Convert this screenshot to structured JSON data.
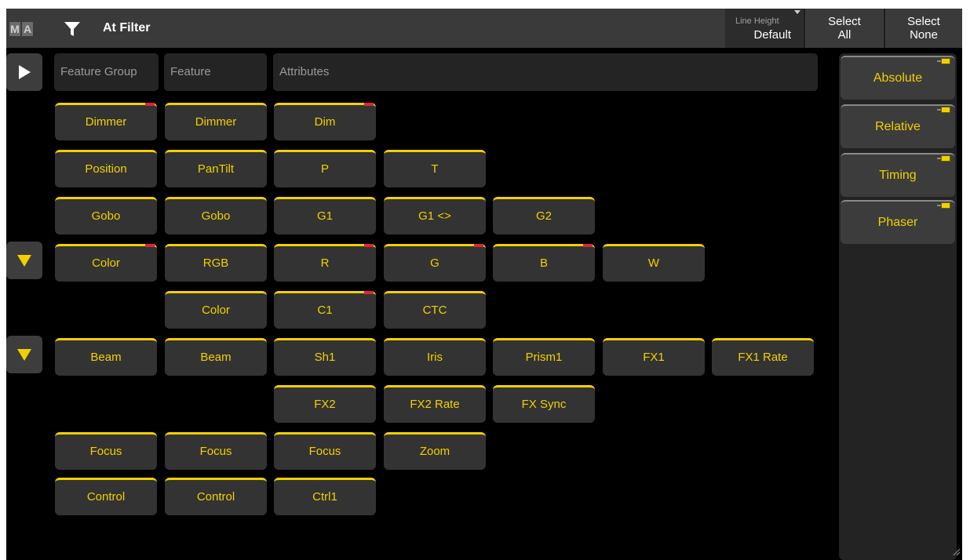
{
  "logo": [
    "M",
    "A"
  ],
  "title": "At Filter",
  "line_height": {
    "label": "Line Height",
    "value": "Default"
  },
  "select_all": {
    "line1": "Select",
    "line2": "All"
  },
  "select_none": {
    "line1": "Select",
    "line2": "None"
  },
  "columns": {
    "feature_group": "Feature Group",
    "feature": "Feature",
    "attributes": "Attributes"
  },
  "rows": [
    {
      "group": "Dimmer",
      "feature": "Dimmer",
      "attributes": [
        "Dim"
      ]
    },
    {
      "group": "Position",
      "feature": "PanTilt",
      "attributes": [
        "P",
        "T"
      ]
    },
    {
      "group": "Gobo",
      "feature": "Gobo",
      "attributes": [
        "G1",
        "G1 <>",
        "G2"
      ]
    },
    {
      "group": "Color",
      "feature": "RGB",
      "attributes": [
        "R",
        "G",
        "B",
        "W"
      ]
    },
    {
      "group": "",
      "feature": "Color",
      "attributes": [
        "C1",
        "CTC"
      ]
    },
    {
      "group": "Beam",
      "feature": "Beam",
      "attributes": [
        "Sh1",
        "Iris",
        "Prism1",
        "FX1",
        "FX1 Rate"
      ]
    },
    {
      "group": "",
      "feature": "",
      "attributes": [
        "FX2",
        "FX2 Rate",
        "FX Sync"
      ]
    },
    {
      "group": "Focus",
      "feature": "Focus",
      "attributes": [
        "Focus",
        "Zoom"
      ]
    },
    {
      "group": "Control",
      "feature": "Control",
      "attributes": [
        "Ctrl1"
      ]
    }
  ],
  "modes": [
    "Absolute",
    "Relative",
    "Timing",
    "Phaser"
  ],
  "colors": {
    "accent": "#f2d000",
    "button": "#333333",
    "flag": "#d9263a",
    "background": "#000000",
    "titlebar": "#3a3a3a"
  }
}
